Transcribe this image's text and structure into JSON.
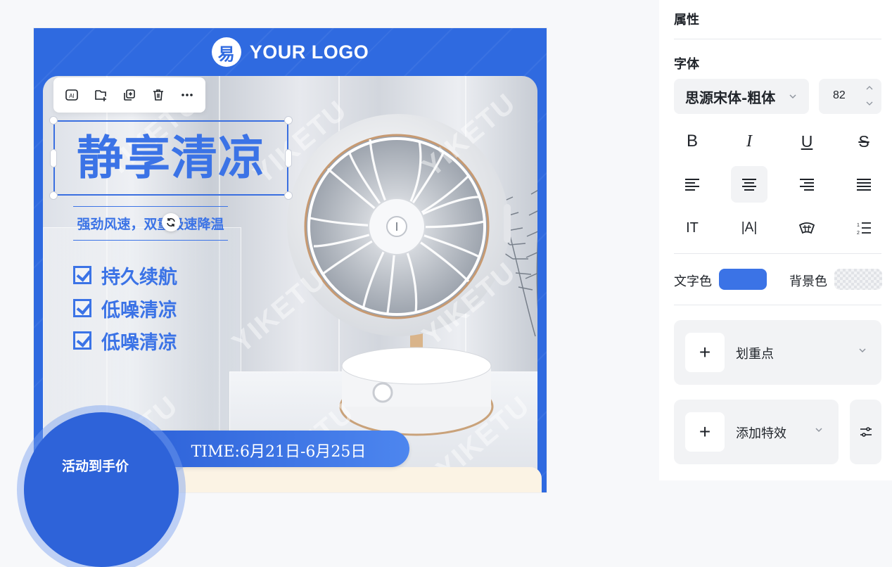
{
  "poster": {
    "logo_mark": "易",
    "logo_text": "YOUR LOGO",
    "headline": "静享清凉",
    "subline": "强劲风速，双重极速降温",
    "features": [
      "持久续航",
      "低噪清凉",
      "低噪清凉"
    ],
    "badge_text": "活动到手价",
    "time_text": "TIME:6月21日-6月25日",
    "watermark": "YIKETU"
  },
  "toolbar": {
    "items": [
      {
        "icon": "ai-text-icon"
      },
      {
        "icon": "add-layer-icon"
      },
      {
        "icon": "duplicate-icon"
      },
      {
        "icon": "trash-icon"
      },
      {
        "icon": "more-icon"
      }
    ]
  },
  "panel": {
    "title": "属性",
    "font_section": "字体",
    "font_name": "思源宋体-粗体",
    "font_size": "82",
    "format_row1": [
      {
        "label": "B",
        "icon": "bold-icon"
      },
      {
        "label": "I",
        "icon": "italic-icon"
      },
      {
        "label": "U",
        "icon": "underline-icon"
      },
      {
        "label": "S",
        "icon": "strikethrough-icon"
      }
    ],
    "align_row": [
      {
        "icon": "align-left-icon",
        "active": false
      },
      {
        "icon": "align-center-icon",
        "active": true
      },
      {
        "icon": "align-right-icon",
        "active": false
      },
      {
        "icon": "align-justify-icon",
        "active": false
      }
    ],
    "format_row3": [
      {
        "label": "IT",
        "icon": "vertical-text-icon"
      },
      {
        "label": "|A|",
        "icon": "letter-spacing-icon"
      },
      {
        "icon": "arc-text-icon"
      },
      {
        "icon": "numbered-list-icon"
      }
    ],
    "text_color_label": "文字色",
    "text_color": "#3b73e6",
    "bg_color_label": "背景色",
    "highlight_label": "划重点",
    "effect_label": "添加特效",
    "plus": "+"
  },
  "colors": {
    "brand_blue": "#2f6ae0",
    "headline_blue": "#3b73e6",
    "panel_bg": "#f2f3f5"
  }
}
